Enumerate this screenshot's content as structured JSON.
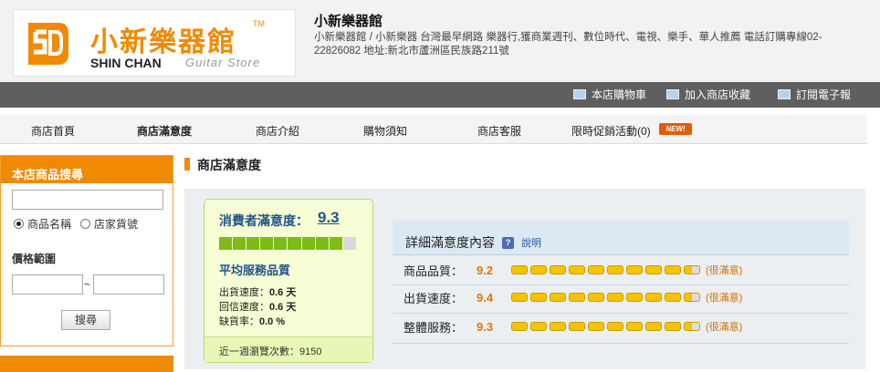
{
  "header": {
    "logo_cn": "小新樂器館",
    "logo_tm": "TM",
    "logo_en": "SHIN CHAN",
    "logo_sub": "Guitar Store",
    "shop_title": "小新樂器館",
    "shop_desc": "小新樂器館 / 小新樂器 台灣最早網路 樂器行,獲商業週刊、數位時代、電視、樂手、華人推薦 電話訂購專線02-22826082 地址:新北市蘆洲區民族路211號",
    "accent_color": "#f08a00"
  },
  "topbar": {
    "cart": "本店購物車",
    "favorite": "加入商店收藏",
    "subscribe": "訂閱電子報"
  },
  "nav": {
    "items": [
      "商店首頁",
      "商店滿意度",
      "商店介紹",
      "購物須知",
      "商店客服",
      "限時促銷活動(0)"
    ],
    "new_badge": "NEW!"
  },
  "sidebar": {
    "search_title": "本店商品搜尋",
    "radio_name": "商品名稱",
    "radio_code": "店家貨號",
    "price_label": "價格範圍",
    "tilde": "~",
    "search_button": "搜尋"
  },
  "main": {
    "title": "商店滿意度",
    "consumer_label": "消費者滿意度：",
    "consumer_score": "9.3",
    "consumer_score_fraction": 0.93,
    "service_title": "平均服務品質",
    "ship_speed_label": "出貨速度：",
    "ship_speed_value": "0.6 天",
    "reply_speed_label": "回信速度：",
    "reply_speed_value": "0.6 天",
    "stockout_label": "缺貨率：",
    "stockout_value": "0.0 %",
    "views_label": "近一週瀏覽次數：",
    "views_value": "9150",
    "detail_title": "詳細滿意度內容",
    "help_icon": "?",
    "help_link": "說明",
    "rows": [
      {
        "label": "商品品質：",
        "score": "9.2",
        "note": "(很滿意)"
      },
      {
        "label": "出貨速度：",
        "score": "9.4",
        "note": "(很滿意)"
      },
      {
        "label": "整體服務：",
        "score": "9.3",
        "note": "(很滿意)"
      }
    ]
  }
}
